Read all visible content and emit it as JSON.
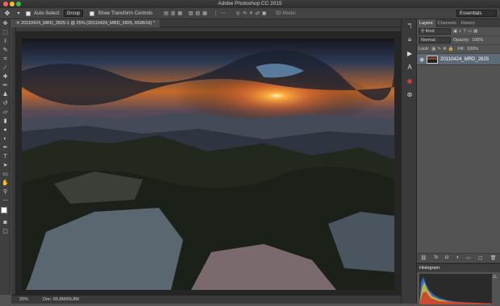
{
  "window": {
    "title": "Adobe Photoshop CC 2015"
  },
  "options_bar": {
    "auto_select_label": "Auto-Select:",
    "auto_select_value": "Group",
    "show_transform_label": "Show Transform Controls",
    "mode_3d_label": "3D Mode:",
    "workspace": "Essentials"
  },
  "document": {
    "tab_label": "20110424_MRD_2825-1 @ 25% (20110424_MRD_2825, RGB/16) *",
    "zoom": "25%",
    "doc_size": "Doc: 69,8M/69,8M"
  },
  "panels": {
    "tabs": [
      "Layers",
      "Channels",
      "History"
    ],
    "filter_kind": "Kind",
    "blend_mode": "Normal",
    "opacity_label": "Opacity:",
    "opacity_value": "100%",
    "lock_label": "Lock:",
    "fill_label": "Fill:",
    "fill_value": "100%",
    "layer_name": "20110424_MRD_2825",
    "histogram_title": "Histogram"
  },
  "icons": {
    "move_tool": "move-icon",
    "layer_visibility": "eye-icon",
    "histogram_warning": "warning-icon"
  },
  "colors": {
    "sun_glow": "#ff8a1e",
    "sky_top": "#1a1d2a",
    "layer_selected": "#5e6a78"
  }
}
